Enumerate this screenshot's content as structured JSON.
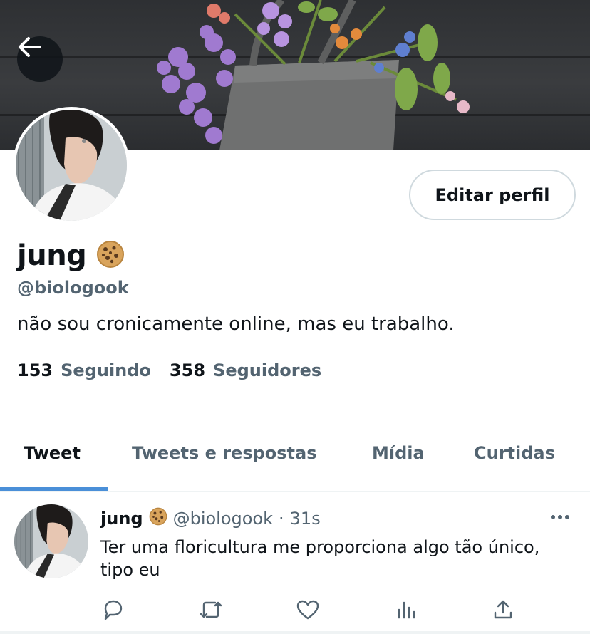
{
  "profile": {
    "display_name": "jung",
    "handle": "@biologook",
    "bio": "não sou cronicamente online, mas eu trabalho.",
    "edit_label": "Editar perfil",
    "following_count": "153",
    "following_label": "Seguindo",
    "followers_count": "358",
    "followers_label": "Seguidores",
    "name_emoji": "cookie-icon"
  },
  "tabs": [
    {
      "label": "Tweet",
      "active": true
    },
    {
      "label": "Tweets e respostas",
      "active": false
    },
    {
      "label": "Mídia",
      "active": false
    },
    {
      "label": "Curtidas",
      "active": false
    }
  ],
  "tweet": {
    "name": "jung",
    "handle": "@biologook",
    "separator": "·",
    "time": "31s",
    "text": "Ter uma floricultura me proporciona algo tão único, tipo eu",
    "actions": [
      "reply-icon",
      "retweet-icon",
      "like-icon",
      "analytics-icon",
      "share-icon"
    ]
  },
  "colors": {
    "accent": "#4a8fd8",
    "text_primary": "#0f1419",
    "text_secondary": "#536471",
    "border": "#cfd9de"
  }
}
